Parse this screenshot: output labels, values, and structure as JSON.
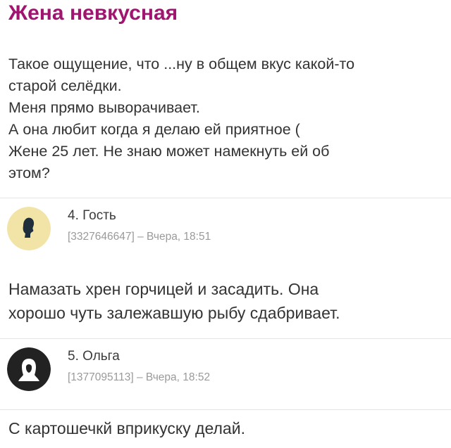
{
  "post": {
    "title": "Жена невкусная",
    "lines": [
      "Такое ощущение, что ...ну в общем вкус какой-то",
      "старой селёдки.",
      "Меня прямо выворачивает.",
      "А она любит когда я делаю ей приятное (",
      "Жене 25 лет. Не знаю может намекнуть ей об",
      "этом?"
    ]
  },
  "comments": [
    {
      "author": "4. Гость",
      "meta": "[3327646647] – Вчера, 18:51",
      "avatar": "guest-avatar",
      "avatar_bg": "#f2e3a6",
      "avatar_fg": "#1e2e3a",
      "lines": [
        "Намазать хрен горчицей и засадить. Она",
        "хорошо чуть залежавшую рыбу сдабривает."
      ]
    },
    {
      "author": "5. Ольга",
      "meta": "[1377095113] – Вчера, 18:52",
      "avatar": "female-user-avatar",
      "avatar_bg": "#222222",
      "avatar_fg": "#ffffff",
      "lines": [
        "С картошечкй вприкуску делай."
      ]
    }
  ],
  "colors": {
    "title": "#a0156f",
    "text": "#333333",
    "meta": "#9a9a9a"
  }
}
